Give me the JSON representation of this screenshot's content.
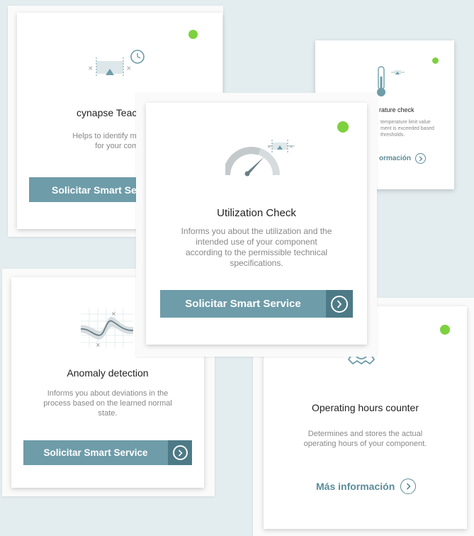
{
  "colors": {
    "background": "#e3ecef",
    "status_green": "#7dd13e",
    "button": "#6e9ca9",
    "button_arrow": "#4d7a86",
    "link": "#5a8b98"
  },
  "cards": {
    "teach": {
      "title": "cynapse Teac",
      "desc1": "Helps to identify meaning",
      "desc2": "for your compone",
      "button_label": "Solicitar Smart Ser",
      "icon": "range-timer-icon"
    },
    "temperature": {
      "title": "rature check",
      "desc1": "temperature limit value",
      "desc2": "ment is exceeded based",
      "desc3": "thresholds.",
      "link_label": "ormación",
      "icon": "thermometer-icon"
    },
    "utilization": {
      "title": "Utilization Check",
      "desc1": "Informs you about the utilization and the",
      "desc2": "intended use of your component",
      "desc3": "according to the permissible technical",
      "desc4": "specifications.",
      "button_label": "Solicitar Smart Service",
      "icon": "gauge-icon"
    },
    "anomaly": {
      "title": "Anomaly detection",
      "desc1": "Informs you about deviations in the",
      "desc2": "process based on the learned normal",
      "desc3": "state.",
      "button_label": "Solicitar Smart Service",
      "icon": "wave-chart-icon"
    },
    "hours": {
      "title": "Operating hours counter",
      "desc1": "Determines and stores the actual",
      "desc2": "operating hours of your component.",
      "link_label": "Más información",
      "icon": "gear-clock-icon"
    }
  }
}
